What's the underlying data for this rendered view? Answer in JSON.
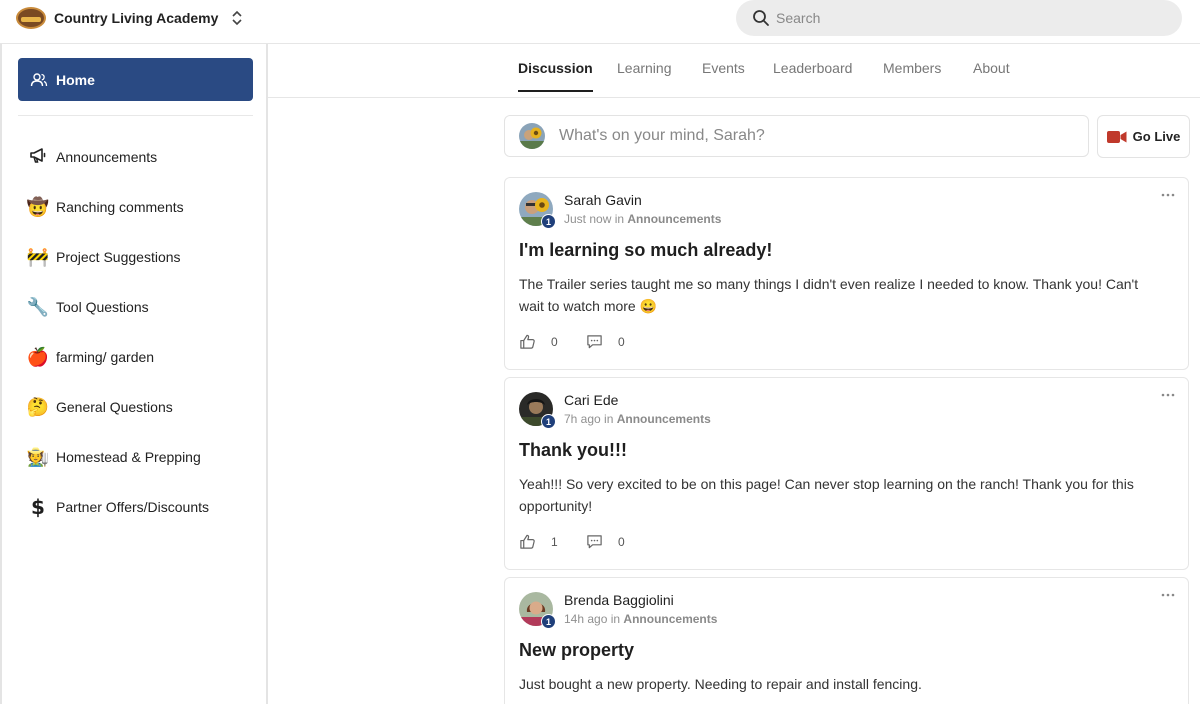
{
  "header": {
    "brand_name": "Country Living Academy",
    "search_placeholder": "Search"
  },
  "sidebar": {
    "home_label": "Home",
    "items": [
      {
        "emoji": "📢",
        "label": "Announcements"
      },
      {
        "emoji": "🤠",
        "label": "Ranching comments"
      },
      {
        "emoji": "🚧",
        "label": "Project Suggestions"
      },
      {
        "emoji": "🔧",
        "label": "Tool Questions"
      },
      {
        "emoji": "🍎",
        "label": "farming/ garden"
      },
      {
        "emoji": "🤔",
        "label": "General Questions"
      },
      {
        "emoji": "🧑‍🌾",
        "label": "Homestead & Prepping"
      },
      {
        "emoji": "$",
        "label": "Partner Offers/Discounts"
      }
    ]
  },
  "tabs": [
    "Discussion",
    "Learning",
    "Events",
    "Leaderboard",
    "Members",
    "About"
  ],
  "composer": {
    "placeholder": "What's on your mind, Sarah?",
    "go_live_label": "Go Live"
  },
  "posts": [
    {
      "author": "Sarah Gavin",
      "level": "1",
      "time": "Just now",
      "in_word": "in",
      "category": "Announcements",
      "title": "I'm learning so much already!",
      "body": "The Trailer series taught me so many things I didn't even realize I needed to know. Thank you! Can't wait to watch more 😀",
      "likes": "0",
      "comments": "0"
    },
    {
      "author": "Cari Ede",
      "level": "1",
      "time": "7h ago",
      "in_word": "in",
      "category": "Announcements",
      "title": "Thank you!!!",
      "body": "Yeah!!! So very excited to be on this page! Can never stop learning on the ranch! Thank you for this opportunity!",
      "likes": "1",
      "comments": "0"
    },
    {
      "author": "Brenda Baggiolini",
      "level": "1",
      "time": "14h ago",
      "in_word": "in",
      "category": "Announcements",
      "title": "New property",
      "body": "Just bought a new property. Needing to repair and install fencing."
    }
  ],
  "colors": {
    "accent": "#2a4a83",
    "level_badge": "#1f3f7a",
    "live_icon": "#c0392b"
  }
}
